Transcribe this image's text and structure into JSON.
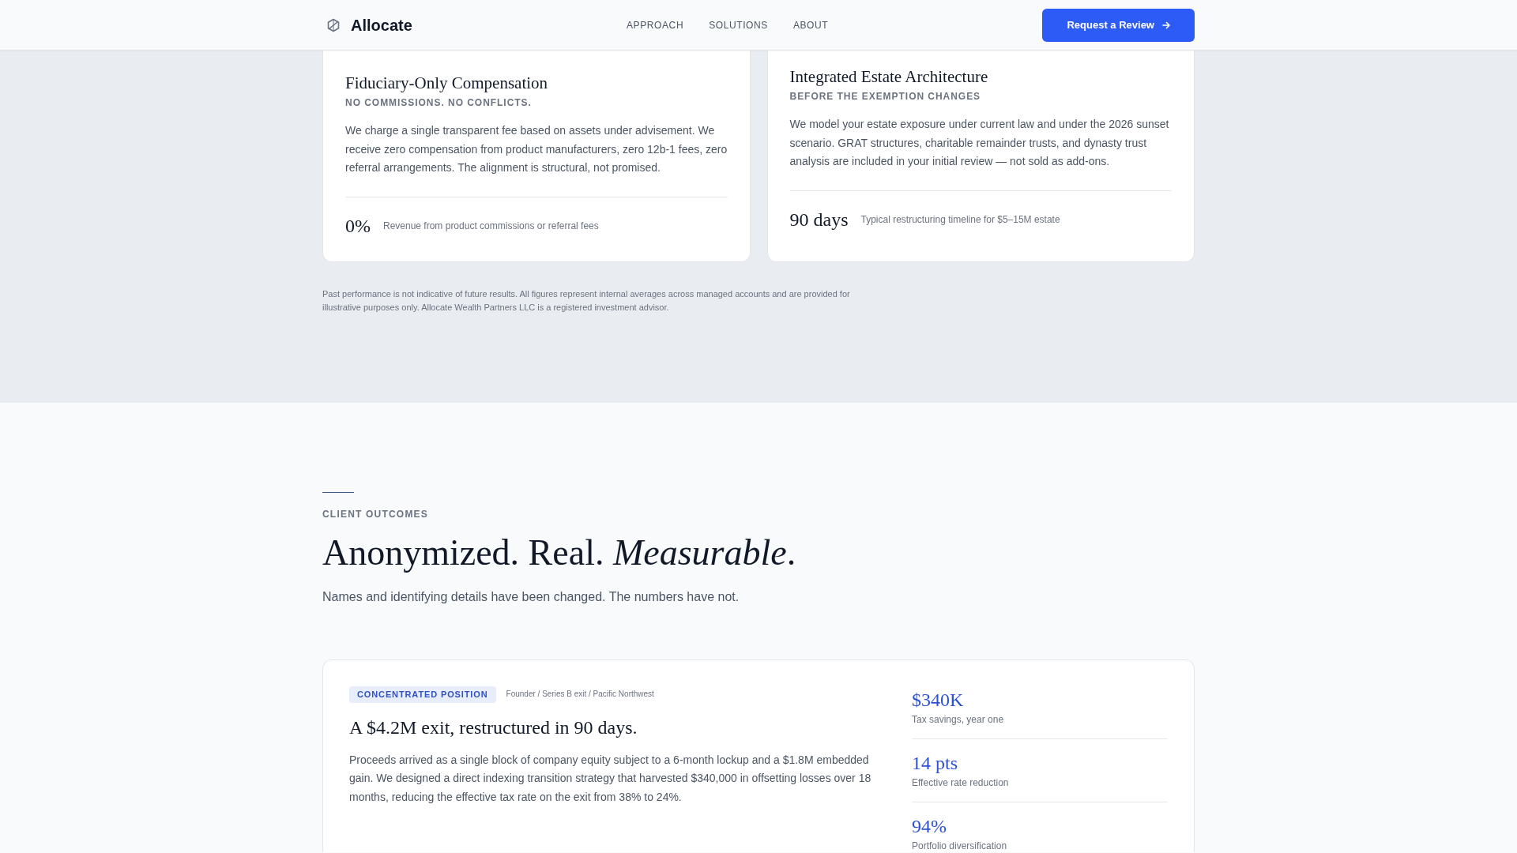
{
  "header": {
    "brand": "Allocate",
    "nav": [
      {
        "label": "APPROACH"
      },
      {
        "label": "SOLUTIONS"
      },
      {
        "label": "ABOUT"
      }
    ],
    "cta": "Request a Review"
  },
  "features": {
    "cards": [
      {
        "title": "Fiduciary-Only Compensation",
        "subtitle": "NO COMMISSIONS. NO CONFLICTS.",
        "body": "We charge a single transparent fee based on assets under advisement. We receive zero compensation from product manufacturers, zero 12b-1 fees, zero referral arrangements. The alignment is structural, not promised.",
        "stat": {
          "value": "0%",
          "label": "Revenue from product commissions or referral fees"
        }
      },
      {
        "title": "Integrated Estate Architecture",
        "subtitle": "BEFORE THE EXEMPTION CHANGES",
        "body": "We model your estate exposure under current law and under the 2026 sunset scenario. GRAT structures, charitable remainder trusts, and dynasty trust analysis are included in your initial review — not sold as add-ons.",
        "stat": {
          "value": "90 days",
          "label": "Typical restructuring timeline for $5–15M estate"
        }
      }
    ],
    "disclaimer": "Past performance is not indicative of future results. All figures represent internal averages across managed accounts and are provided for illustrative purposes only. Allocate Wealth Partners LLC is a registered investment advisor."
  },
  "outcomes": {
    "eyebrow": "CLIENT OUTCOMES",
    "heading": "Anonymized. Real. *Measurable*.",
    "subheading": "Names and identifying details have been changed. The numbers have not.",
    "cases": [
      {
        "tag": "CONCENTRATED POSITION",
        "meta": "Founder / Series B exit / Pacific Northwest",
        "title": "A $4.2M exit, restructured in 90 days.",
        "body": "Proceeds arrived as a single block of company equity subject to a 6-month lockup and a $1.8M embedded gain. We designed a direct indexing transition strategy that harvested $340,000 in offsetting losses over 18 months, reducing the effective tax rate on the exit from 38% to 24%.",
        "stats": [
          {
            "value": "$340K",
            "label": "Tax savings, year one"
          },
          {
            "value": "14 pts",
            "label": "Effective rate reduction"
          },
          {
            "value": "94%",
            "label": "Portfolio diversification"
          }
        ]
      }
    ]
  }
}
